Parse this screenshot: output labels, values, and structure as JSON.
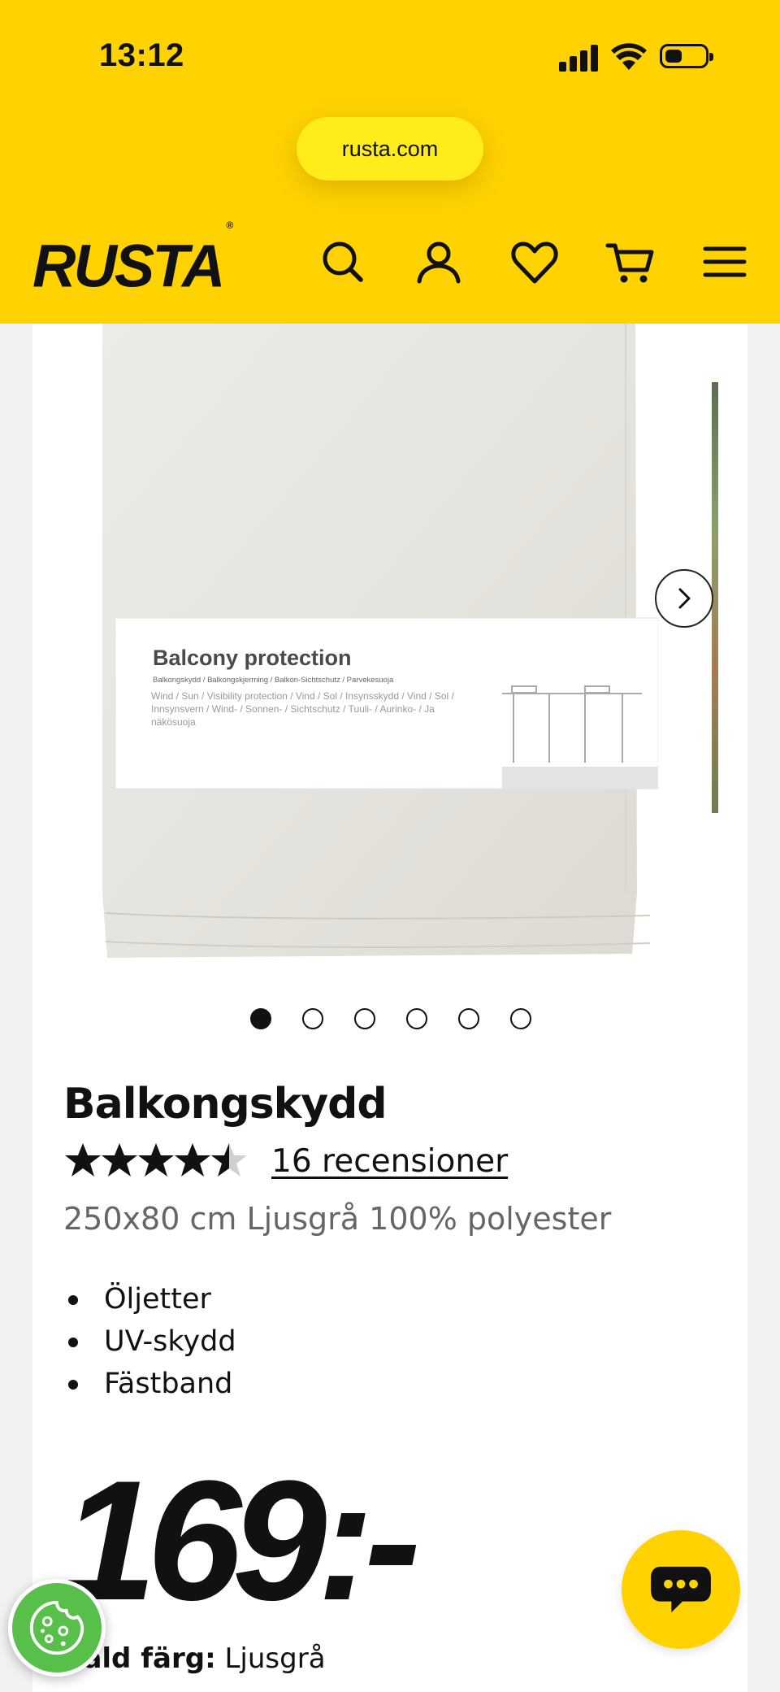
{
  "status_bar": {
    "time": "13:12"
  },
  "browser": {
    "url": "rusta.com"
  },
  "header": {
    "logo": "RUSTA",
    "logo_mark": "®",
    "icons": [
      "search-icon",
      "account-icon",
      "heart-icon",
      "cart-icon",
      "menu-icon"
    ]
  },
  "gallery": {
    "image_count": 6,
    "active_index": 0,
    "package_text": {
      "title": "Balcony protection",
      "languages": "Balkongskydd / Balkongskjerming / Balkon-Sichtschutz / Parvekesuoja",
      "features": "Wind / Sun / Visibility protection / Vind / Sol / Insynsskydd / Vind / Sol / Innsynsvern / Wind- / Sonnen- / Sichtschutz / Tuuli- / Aurinko- / Ja näkösuoja"
    }
  },
  "product": {
    "name": "Balkongskydd",
    "rating": 4.5,
    "rating_max": 5,
    "reviews_label": "16 recensioner",
    "description": "250x80 cm Ljusgrå 100% polyester",
    "features": [
      "Öljetter",
      "UV-skydd",
      "Fästband"
    ],
    "price": "169:-",
    "color_label": "Vald färg:",
    "color_value": "Ljusgrå"
  },
  "colors": {
    "brand_yellow": "#ffd200",
    "url_pill": "#ffec1a",
    "cookie_green": "#58c04a"
  }
}
